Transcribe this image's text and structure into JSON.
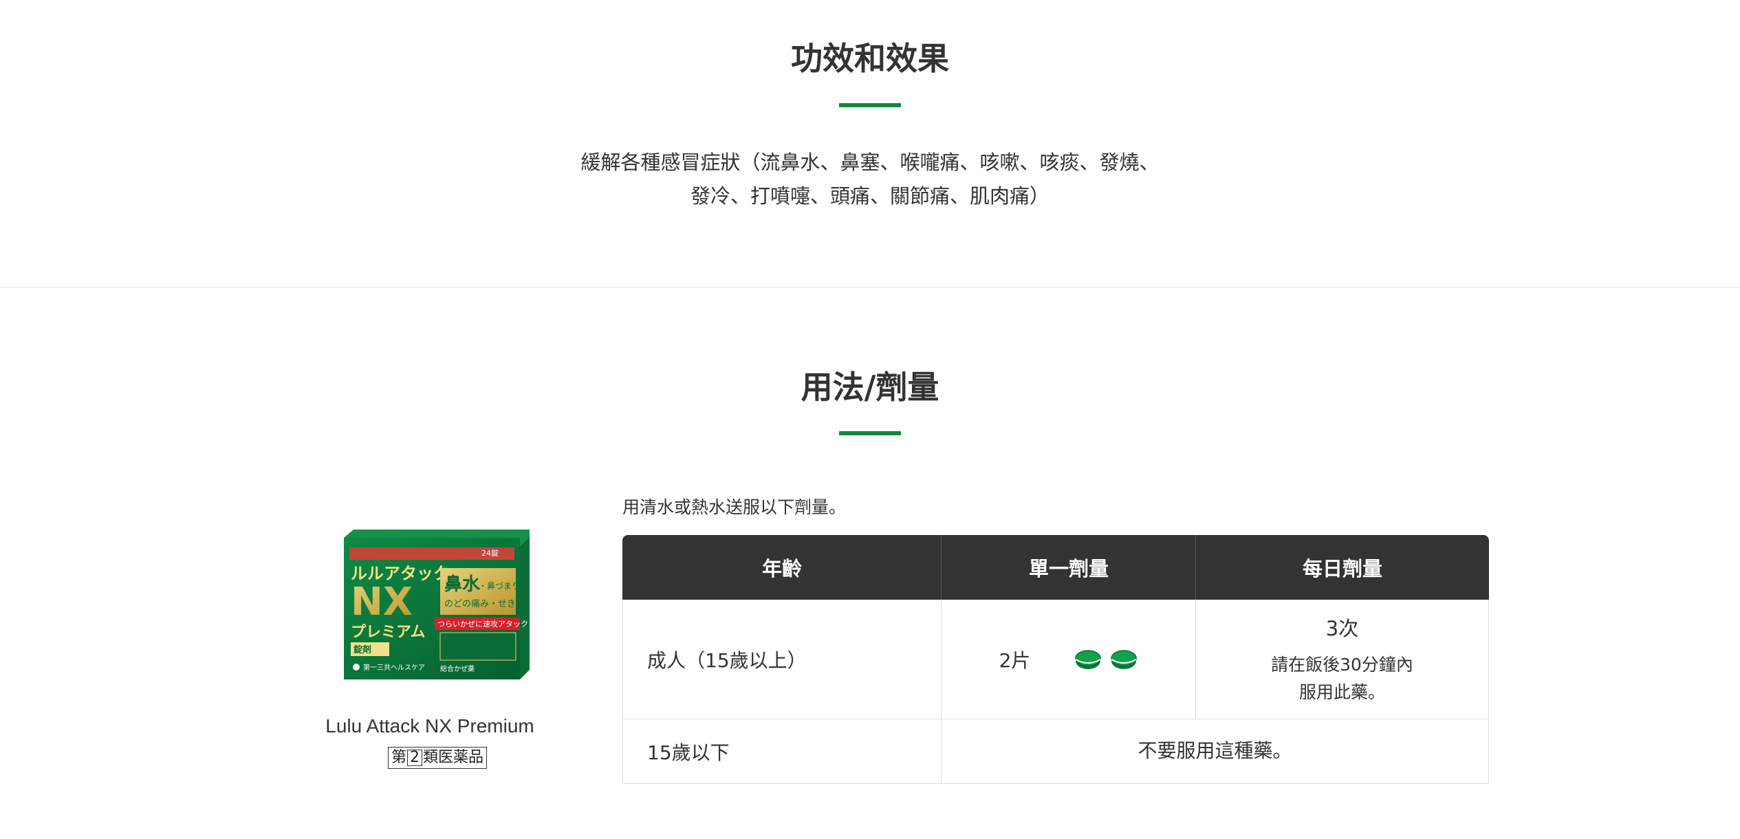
{
  "effects": {
    "title": "功效和效果",
    "line1": "緩解各種感冒症狀（流鼻水、鼻塞、喉嚨痛、咳嗽、咳痰、發燒、",
    "line2": "發冷、打噴嚏、頭痛、關節痛、肌肉痛）"
  },
  "usage": {
    "title": "用法/劑量",
    "intro": "用清水或熱水送服以下劑量。",
    "table": {
      "headers": [
        "年齡",
        "單一劑量",
        "每日劑量"
      ],
      "rows": [
        {
          "age": "成人（15歲以上）",
          "single_dose": "2片",
          "daily_main": "3次",
          "daily_note_1": "請在飯後30分鐘內",
          "daily_note_2": "服用此藥。"
        },
        {
          "age": "15歲以下",
          "note": "不要服用這種藥。"
        }
      ]
    }
  },
  "product": {
    "name": "Lulu Attack NX Premium",
    "category_prefix": "第",
    "category_num": "2",
    "category_suffix": "類医薬品",
    "box": {
      "brand_kana": "ルルアタック",
      "brand_nx": "NX",
      "brand_premium": "プレミアム",
      "count": "24錠",
      "claim_main": "鼻水",
      "claim_sub1": "・鼻づまり",
      "claim_sub2": "のどの痛み・せきに",
      "red_band": "つらいかぜに速攻アタック",
      "form": "錠剤",
      "maker": "第一三共ヘルスケア",
      "footer": "総合かぜ薬"
    }
  },
  "colors": {
    "accent": "#0d8a3a",
    "header_bg": "#333333",
    "border": "#dddddd"
  }
}
